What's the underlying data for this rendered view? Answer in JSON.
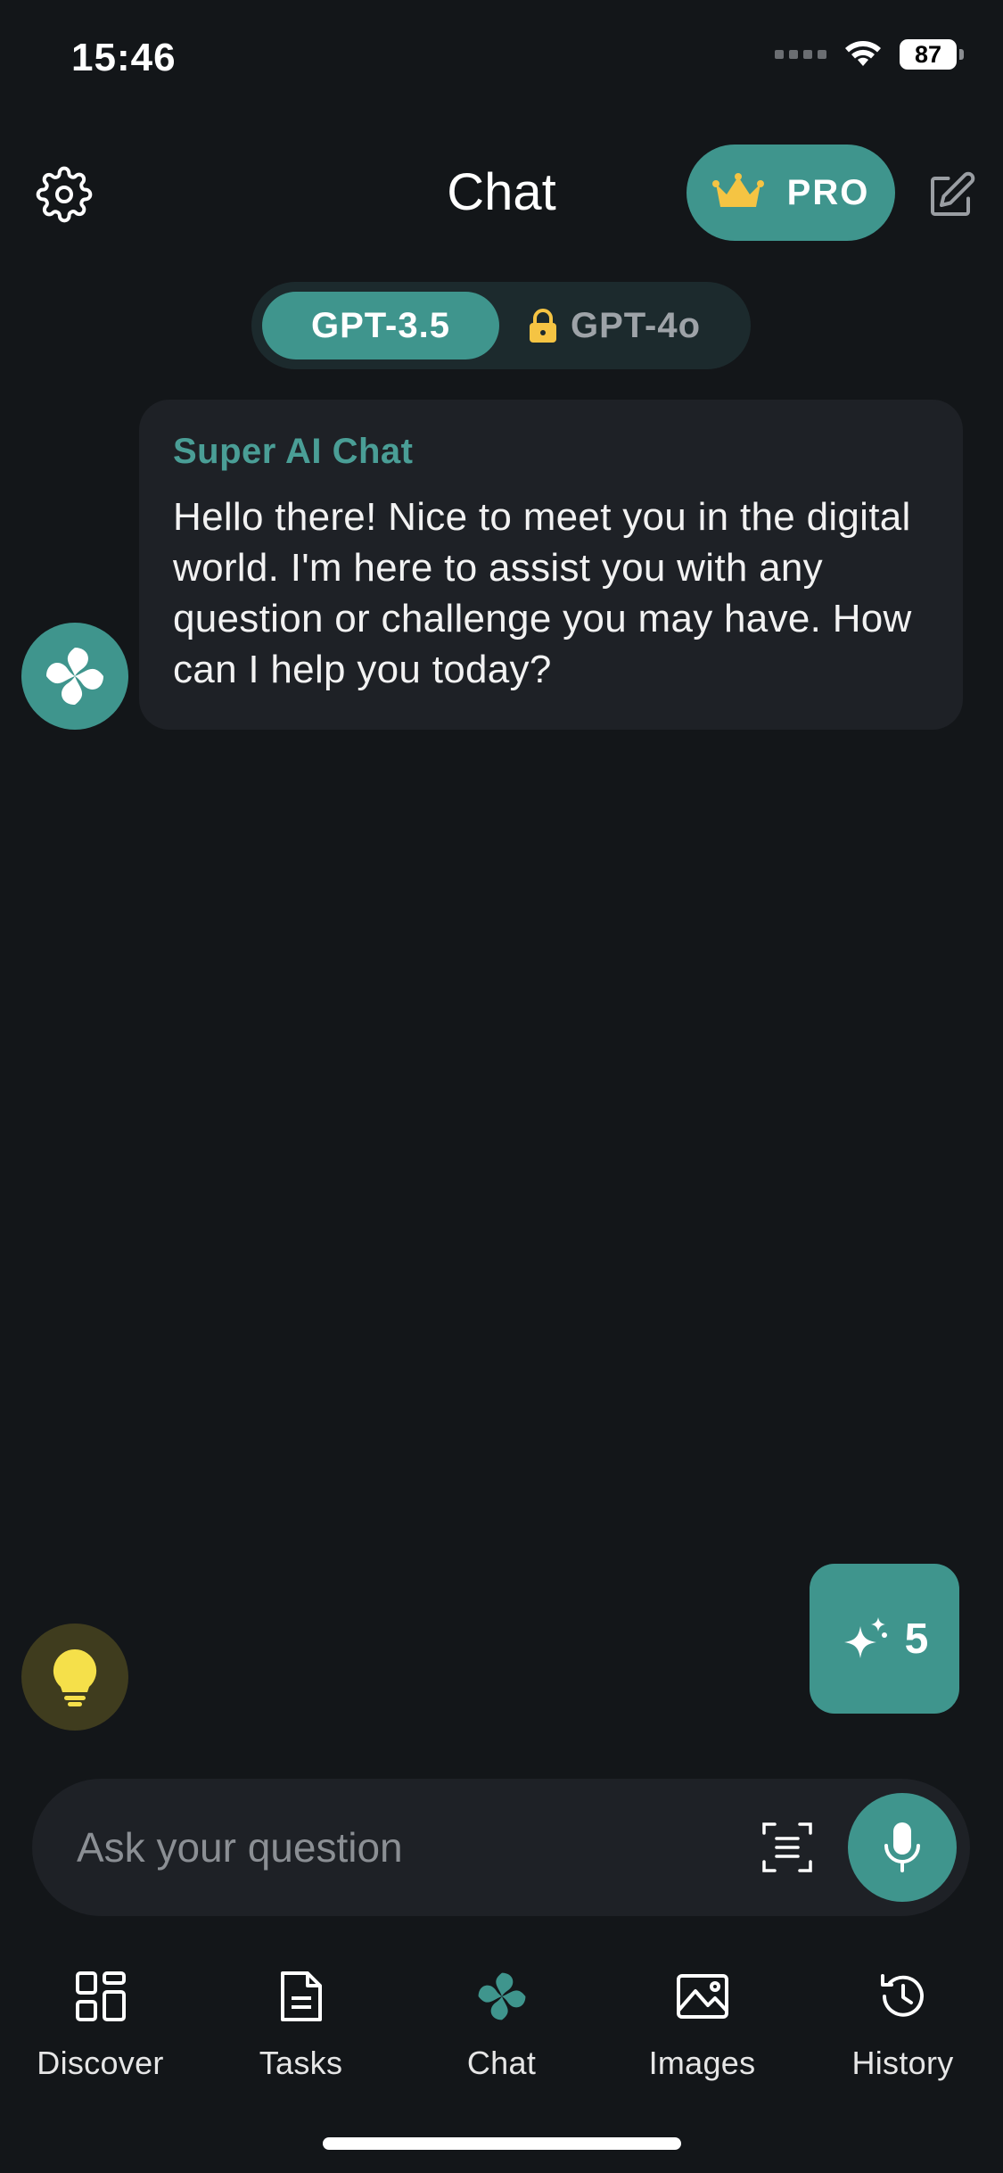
{
  "status_bar": {
    "time": "15:46",
    "battery": "87"
  },
  "header": {
    "title": "Chat",
    "pro_label": "PRO"
  },
  "model_toggle": {
    "active": "GPT-3.5",
    "locked": "GPT-4o"
  },
  "message": {
    "sender": "Super AI Chat",
    "text": "Hello there! Nice to meet you in the digital world. I'm here to assist you with any question or challenge you may have. How can I help you today?"
  },
  "credits": {
    "count": "5"
  },
  "input": {
    "placeholder": "Ask your question"
  },
  "tabs": [
    {
      "label": "Discover",
      "icon": "grid-icon"
    },
    {
      "label": "Tasks",
      "icon": "document-icon"
    },
    {
      "label": "Chat",
      "icon": "chat-logo-icon"
    },
    {
      "label": "Images",
      "icon": "image-icon"
    },
    {
      "label": "History",
      "icon": "history-icon"
    }
  ],
  "colors": {
    "accent": "#3f958d",
    "background": "#131619",
    "bubble": "#1e2126",
    "crown": "#f5c443",
    "bulb": "#f5e04a"
  }
}
